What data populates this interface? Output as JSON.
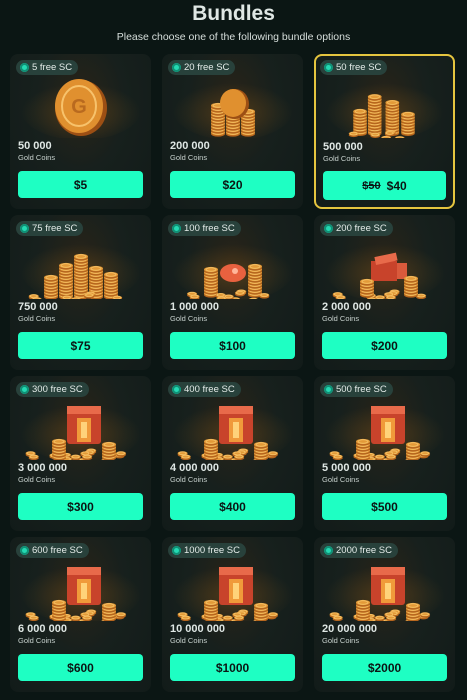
{
  "header": {
    "title": "Bundles",
    "subtitle": "Please choose one of the following bundle options"
  },
  "colors": {
    "background": "#0b1614",
    "accent": "#1effc3",
    "badge_bg": "#28413b",
    "featured_border": "#e5c53f",
    "coin_gold": "#d98b2b",
    "chest_red": "#e05a3a"
  },
  "bundles": [
    {
      "free_sc": "5 free SC",
      "amount": "50 000",
      "unit": "Gold Coins",
      "price": "$5",
      "old_price": "",
      "icon": "single-gold-coin-icon",
      "featured": false
    },
    {
      "free_sc": "20 free SC",
      "amount": "200 000",
      "unit": "Gold Coins",
      "price": "$20",
      "old_price": "",
      "icon": "coin-stack-small-icon",
      "featured": false
    },
    {
      "free_sc": "50 free SC",
      "amount": "500 000",
      "unit": "Gold Coins",
      "price": "$40",
      "old_price": "$50",
      "icon": "coin-stack-medium-icon",
      "featured": true
    },
    {
      "free_sc": "75 free SC",
      "amount": "750 000",
      "unit": "Gold Coins",
      "price": "$75",
      "old_price": "",
      "icon": "coin-pile-large-icon",
      "featured": false
    },
    {
      "free_sc": "100 free SC",
      "amount": "1 000 000",
      "unit": "Gold Coins",
      "price": "$100",
      "old_price": "",
      "icon": "coin-pile-with-gem-icon",
      "featured": false
    },
    {
      "free_sc": "200 free SC",
      "amount": "2 000 000",
      "unit": "Gold Coins",
      "price": "$200",
      "old_price": "",
      "icon": "coin-pile-with-chest-icon",
      "featured": false
    },
    {
      "free_sc": "300 free SC",
      "amount": "3 000 000",
      "unit": "Gold Coins",
      "price": "$300",
      "old_price": "",
      "icon": "treasure-chest-icon",
      "featured": false
    },
    {
      "free_sc": "400 free SC",
      "amount": "4 000 000",
      "unit": "Gold Coins",
      "price": "$400",
      "old_price": "",
      "icon": "treasure-chest-icon",
      "featured": false
    },
    {
      "free_sc": "500 free SC",
      "amount": "5 000 000",
      "unit": "Gold Coins",
      "price": "$500",
      "old_price": "",
      "icon": "treasure-chest-icon",
      "featured": false
    },
    {
      "free_sc": "600 free SC",
      "amount": "6 000 000",
      "unit": "Gold Coins",
      "price": "$600",
      "old_price": "",
      "icon": "treasure-chest-icon",
      "featured": false
    },
    {
      "free_sc": "1000 free SC",
      "amount": "10 000 000",
      "unit": "Gold Coins",
      "price": "$1000",
      "old_price": "",
      "icon": "treasure-chest-icon",
      "featured": false
    },
    {
      "free_sc": "2000 free SC",
      "amount": "20 000 000",
      "unit": "Gold Coins",
      "price": "$2000",
      "old_price": "",
      "icon": "treasure-chest-icon",
      "featured": false
    }
  ]
}
